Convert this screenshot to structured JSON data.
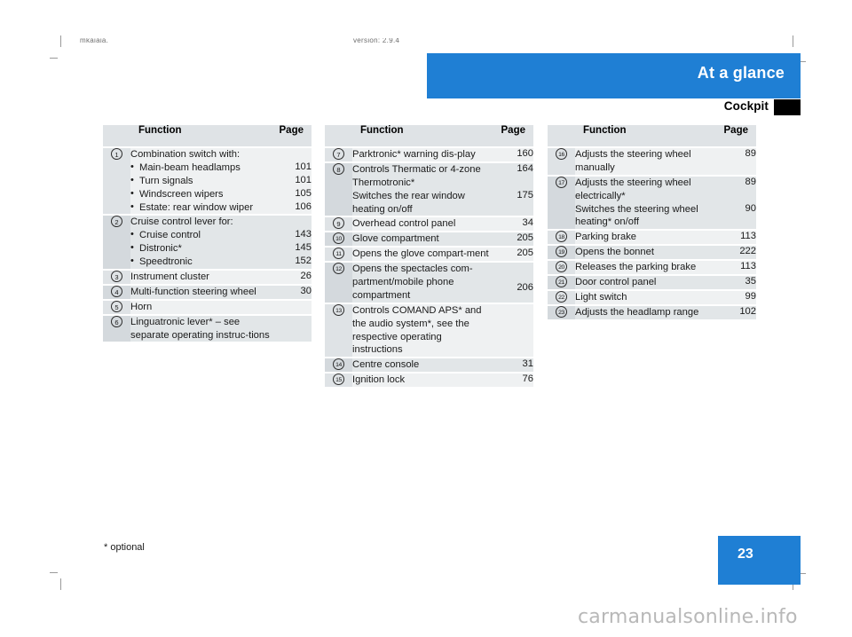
{
  "page": {
    "clipped_header_left": "mkaiaia,",
    "clipped_header_right": "version: 2.9.4",
    "footnote": "* optional",
    "page_number": "23",
    "watermark": "carmanualsonline.info",
    "accent_color": "#1f7fd4",
    "table_header_color": "#dfe3e6",
    "row_color": "#eff1f2",
    "row_color_alt": "#e2e6e8"
  },
  "header": {
    "title": "At a glance",
    "subtitle": "Cockpit"
  },
  "table_headers": {
    "function": "Function",
    "page": "Page"
  },
  "columns": [
    {
      "id": "column-1",
      "groups": [
        {
          "number": "1",
          "rows": [
            {
              "type": "title",
              "text": "Combination switch with:",
              "page": ""
            },
            {
              "type": "bullet",
              "text": "Main-beam headlamps",
              "page": "101"
            },
            {
              "type": "bullet",
              "text": "Turn signals",
              "page": "101"
            },
            {
              "type": "bullet",
              "text": "Windscreen wipers",
              "page": "105"
            },
            {
              "type": "bullet",
              "text": "Estate: rear window wiper",
              "page": "106"
            }
          ]
        },
        {
          "number": "2",
          "rows": [
            {
              "type": "title",
              "text": "Cruise control lever for:",
              "page": ""
            },
            {
              "type": "bullet",
              "text": "Cruise control",
              "page": "143"
            },
            {
              "type": "bullet",
              "text": "Distronic*",
              "page": "145"
            },
            {
              "type": "bullet",
              "text": "Speedtronic",
              "page": "152"
            }
          ]
        },
        {
          "number": "3",
          "rows": [
            {
              "type": "plain",
              "text": "Instrument cluster",
              "page": "26"
            }
          ]
        },
        {
          "number": "4",
          "rows": [
            {
              "type": "plain",
              "text": "Multi-function steering wheel",
              "page": "30"
            }
          ]
        },
        {
          "number": "5",
          "rows": [
            {
              "type": "plain",
              "text": "Horn",
              "page": ""
            }
          ]
        },
        {
          "number": "6",
          "rows": [
            {
              "type": "plain",
              "text": "Linguatronic lever* – see separate operating instruc-tions",
              "page": ""
            }
          ]
        }
      ]
    },
    {
      "id": "column-2",
      "groups": [
        {
          "number": "7",
          "rows": [
            {
              "type": "plain",
              "text": "Parktronic* warning dis-play",
              "page": "160"
            }
          ]
        },
        {
          "number": "8",
          "rows": [
            {
              "type": "plain",
              "text": "Controls Thermatic or 4-zone Thermotronic*",
              "page": "164"
            },
            {
              "type": "plain",
              "text": "Switches the rear window heating on/off",
              "page": "175"
            }
          ]
        },
        {
          "number": "9",
          "rows": [
            {
              "type": "plain",
              "text": "Overhead control panel",
              "page": "34"
            }
          ]
        },
        {
          "number": "10",
          "rows": [
            {
              "type": "plain",
              "text": "Glove compartment",
              "page": "205"
            }
          ]
        },
        {
          "number": "11",
          "rows": [
            {
              "type": "plain",
              "text": "Opens the glove compart-ment",
              "page": "205"
            }
          ]
        },
        {
          "number": "12",
          "rows": [
            {
              "type": "plain",
              "text": "Opens the spectacles com-partment/mobile phone compartment",
              "page": "206"
            }
          ]
        },
        {
          "number": "13",
          "rows": [
            {
              "type": "plain",
              "text": "Controls COMAND APS* and the audio system*, see the respective operating instructions",
              "page": ""
            }
          ]
        },
        {
          "number": "14",
          "rows": [
            {
              "type": "plain",
              "text": "Centre console",
              "page": "31"
            }
          ]
        },
        {
          "number": "15",
          "rows": [
            {
              "type": "plain",
              "text": "Ignition lock",
              "page": "76"
            }
          ]
        }
      ]
    },
    {
      "id": "column-3",
      "groups": [
        {
          "number": "16",
          "rows": [
            {
              "type": "plain",
              "text": "Adjusts the steering wheel manually",
              "page": "89"
            }
          ]
        },
        {
          "number": "17",
          "rows": [
            {
              "type": "plain",
              "text": "Adjusts the steering wheel electrically*",
              "page": "89"
            },
            {
              "type": "plain",
              "text": "Switches the steering wheel heating* on/off",
              "page": "90"
            }
          ]
        },
        {
          "number": "18",
          "rows": [
            {
              "type": "plain",
              "text": "Parking brake",
              "page": "113"
            }
          ]
        },
        {
          "number": "19",
          "rows": [
            {
              "type": "plain",
              "text": "Opens the bonnet",
              "page": "222"
            }
          ]
        },
        {
          "number": "20",
          "rows": [
            {
              "type": "plain",
              "text": "Releases the parking brake",
              "page": "113"
            }
          ]
        },
        {
          "number": "21",
          "rows": [
            {
              "type": "plain",
              "text": "Door control panel",
              "page": "35"
            }
          ]
        },
        {
          "number": "22",
          "rows": [
            {
              "type": "plain",
              "text": "Light switch",
              "page": "99"
            }
          ]
        },
        {
          "number": "23",
          "rows": [
            {
              "type": "plain",
              "text": "Adjusts the headlamp range",
              "page": "102"
            }
          ]
        }
      ]
    }
  ]
}
